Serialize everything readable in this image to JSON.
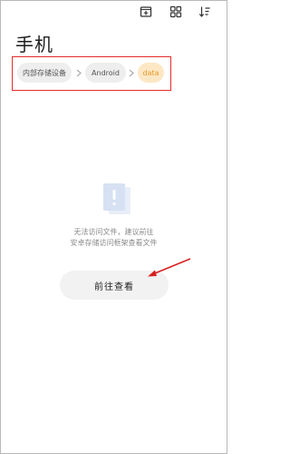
{
  "toolbar": {
    "icons": [
      "new-folder-icon",
      "grid-view-icon",
      "sort-icon"
    ]
  },
  "title": "手机",
  "breadcrumb": {
    "items": [
      {
        "label": "内部存储设备"
      },
      {
        "label": "Android"
      },
      {
        "label": "data"
      }
    ],
    "active_color": "#e79a2a"
  },
  "empty_state": {
    "icon": "exclamation-document-icon",
    "message_line1": "无法访问文件，建议前往",
    "message_line2": "安卓存储访问框架查看文件",
    "button_label": "前往查看"
  },
  "annotation": {
    "box_color": "#e52b2b",
    "arrow_color": "#d62020"
  }
}
